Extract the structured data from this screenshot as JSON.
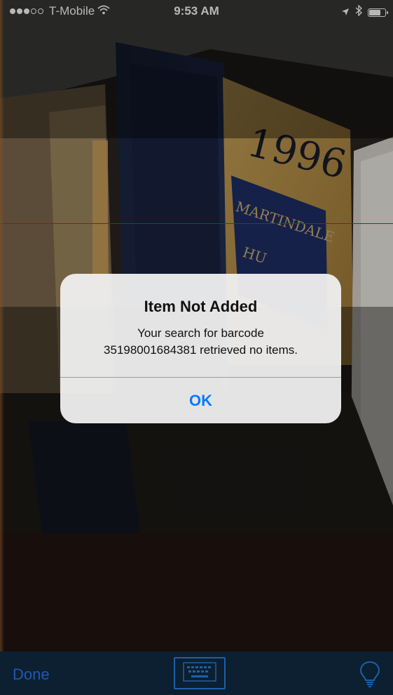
{
  "status_bar": {
    "carrier": "T-Mobile",
    "time": "9:53 AM",
    "signal_bars_filled": 3,
    "signal_bars_total": 5,
    "battery_level": 0.8
  },
  "alert": {
    "title": "Item Not Added",
    "message_line1": "Your search for barcode",
    "message_line2": "35198001684381 retrieved no items.",
    "ok_label": "OK"
  },
  "toolbar": {
    "done_label": "Done"
  },
  "camera_scene": {
    "book_spine_text": "1996",
    "book_label_1": "MARTINDALE",
    "book_label_2": "HU"
  },
  "colors": {
    "scan_line": "#c4251f",
    "alert_button": "#0a7bff",
    "toolbar_bg": "#0c2031",
    "toolbar_tint": "#1f58b4"
  },
  "icons": {
    "wifi": "wifi-icon",
    "location": "location-arrow-icon",
    "bluetooth": "bluetooth-icon",
    "battery": "battery-icon",
    "keyboard": "keyboard-icon",
    "flashlight": "lightbulb-icon"
  }
}
